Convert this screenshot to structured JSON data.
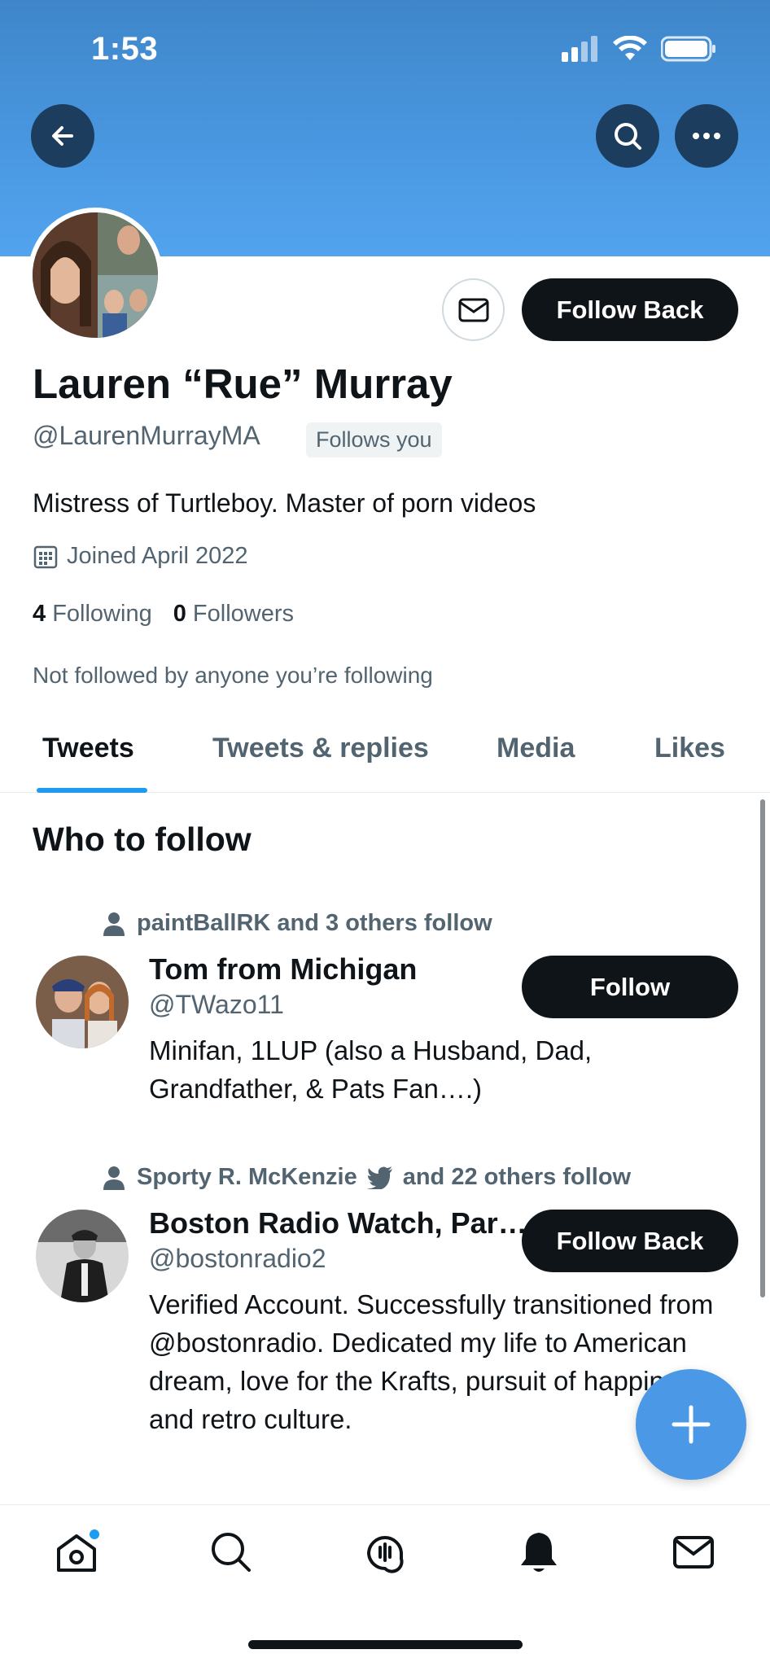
{
  "status": {
    "time": "1:53"
  },
  "profile": {
    "name": "Lauren “Rue” Murray",
    "handle": "@LaurenMurrayMA",
    "follows_you": "Follows you",
    "bio": "Mistress of Turtleboy. Master of porn videos",
    "joined": "Joined April 2022",
    "following_count": "4",
    "following_label": "Following",
    "followers_count": "0",
    "followers_label": "Followers",
    "not_followed": "Not followed by anyone you’re following",
    "follow_back_label": "Follow Back"
  },
  "tabs": [
    "Tweets",
    "Tweets & replies",
    "Media",
    "Likes"
  ],
  "who_to_follow": {
    "title": "Who to follow",
    "users": [
      {
        "social_a": "paintBallRK and 3 others follow",
        "name": "Tom from Michigan",
        "handle": "@TWazo11",
        "bio": "Minifan, 1LUP (also a Husband, Dad, Grandfather, & Pats Fan….)",
        "button": "Follow"
      },
      {
        "social_a": "Sporty R. McKenzie",
        "social_b": "and 22 others follow",
        "name": "Boston Radio Watch, Par…",
        "handle": "@bostonradio2",
        "bio": "Verified Account. Successfully transitioned from @bostonradio. Dedicated my life to American dream, love for the Krafts, pursuit of happiness and retro culture.",
        "button": "Follow Back"
      }
    ]
  },
  "colors": {
    "accent": "#1d9bf0",
    "banner": "#4a98e2",
    "dark": "#0f1419",
    "muted": "#536471"
  }
}
